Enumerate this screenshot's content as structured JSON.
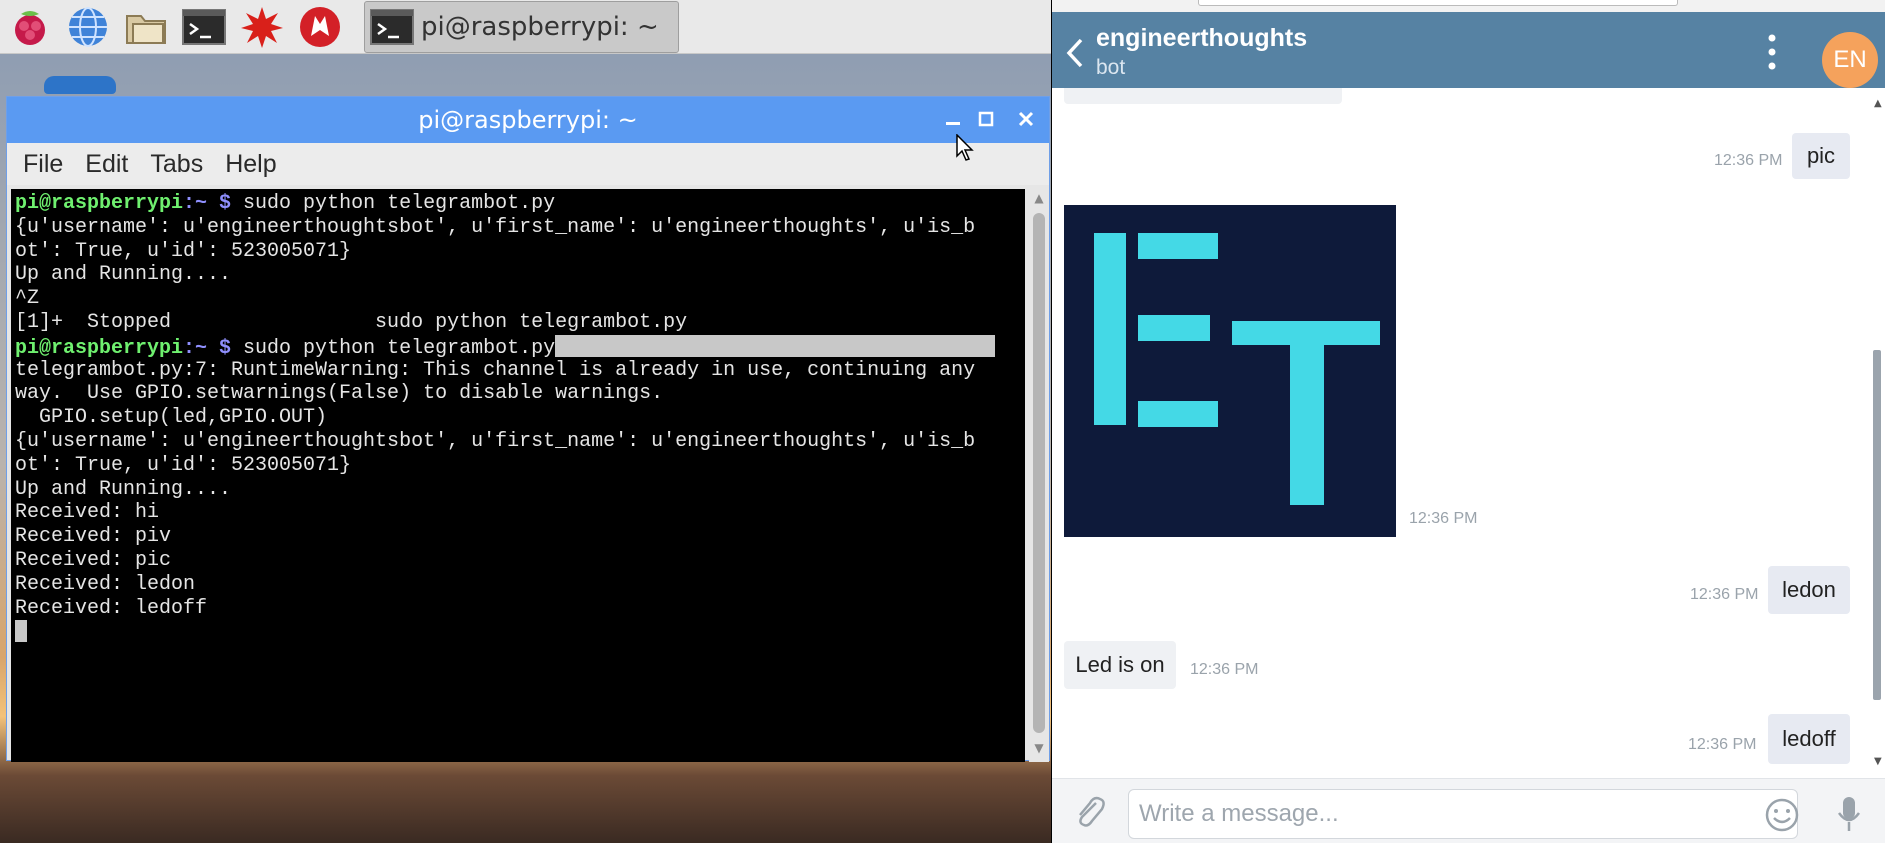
{
  "taskbar": {
    "icons": [
      "raspberry-menu-icon",
      "web-browser-icon",
      "file-manager-icon",
      "terminal-icon",
      "mathematica-icon",
      "wolfram-icon"
    ],
    "task_label": "pi@raspberrypi: ~"
  },
  "terminal": {
    "title": "pi@raspberrypi: ~",
    "menu": [
      "File",
      "Edit",
      "Tabs",
      "Help"
    ],
    "lines": {
      "l1_prompt": "pi@raspberrypi",
      "l1_path": ":~ $",
      "l1_cmd": " sudo python telegrambot.py",
      "l2": "{u'username': u'engineerthoughtsbot', u'first_name': u'engineerthoughts', u'is_b",
      "l3": "ot': True, u'id': 523005071}",
      "l4": "Up and Running....",
      "l5": "^Z",
      "l6": "[1]+  Stopped                 sudo python telegrambot.py",
      "l7_prompt": "pi@raspberrypi",
      "l7_path": ":~ $",
      "l7_cmd": " sudo python telegrambot.py",
      "l8": "telegrambot.py:7: RuntimeWarning: This channel is already in use, continuing any",
      "l9": "way.  Use GPIO.setwarnings(False) to disable warnings.",
      "l10": "  GPIO.setup(led,GPIO.OUT)",
      "l11": "{u'username': u'engineerthoughtsbot', u'first_name': u'engineerthoughts', u'is_b",
      "l12": "ot': True, u'id': 523005071}",
      "l13": "Up and Running....",
      "l14": "Received: hi",
      "l15": "Received: piv",
      "l16": "Received: pic",
      "l17": "Received: ledon",
      "l18": "Received: ledoff"
    }
  },
  "telegram": {
    "chat_title": "engineerthoughts",
    "chat_subtitle": "bot",
    "avatar_initials": "EN",
    "messages": [
      {
        "direction": "out",
        "text": "pic",
        "time": "12:36 PM"
      },
      {
        "direction": "in",
        "type": "image",
        "image_text": "ET",
        "time": "12:36 PM"
      },
      {
        "direction": "out",
        "text": "ledon",
        "time": "12:36 PM"
      },
      {
        "direction": "in",
        "text": "Led is on",
        "time": "12:36 PM"
      },
      {
        "direction": "out",
        "text": "ledoff",
        "time": "12:36 PM"
      }
    ],
    "composer_placeholder": "Write a message...",
    "colors": {
      "header": "#5682a3",
      "avatar": "#f5a25c",
      "logo_bg": "#0e1a3a",
      "logo_fg": "#44d9e6"
    }
  }
}
